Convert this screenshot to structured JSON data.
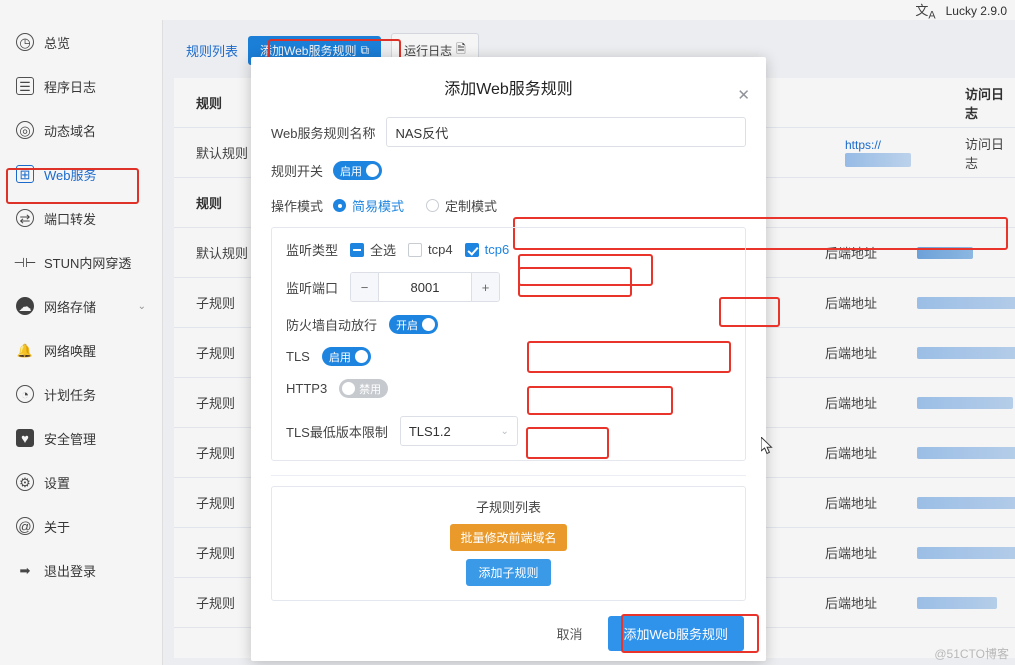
{
  "topbar": {
    "lang_icon": "language-icon",
    "version": "Lucky 2.9.0"
  },
  "sidebar": {
    "items": [
      {
        "label": "总览",
        "icon": "dashboard-icon",
        "name": "overview"
      },
      {
        "label": "程序日志",
        "icon": "log-icon",
        "name": "logs"
      },
      {
        "label": "动态域名",
        "icon": "ddns-icon",
        "name": "ddns"
      },
      {
        "label": "Web服务",
        "icon": "web-service-icon",
        "name": "web-service"
      },
      {
        "label": "端口转发",
        "icon": "port-forward-icon",
        "name": "port-forward"
      },
      {
        "label": "STUN内网穿透",
        "icon": "stun-icon",
        "name": "stun"
      },
      {
        "label": "网络存储",
        "icon": "storage-icon",
        "name": "storage",
        "chevron": "⌄"
      },
      {
        "label": "网络唤醒",
        "icon": "wol-icon",
        "name": "wol"
      },
      {
        "label": "计划任务",
        "icon": "schedule-icon",
        "name": "schedule"
      },
      {
        "label": "安全管理",
        "icon": "security-icon",
        "name": "security"
      },
      {
        "label": "设置",
        "icon": "settings-icon",
        "name": "settings"
      },
      {
        "label": "关于",
        "icon": "about-icon",
        "name": "about"
      },
      {
        "label": "退出登录",
        "icon": "logout-icon",
        "name": "logout"
      }
    ],
    "active_index": 3
  },
  "main": {
    "tab_label": "规则列表",
    "add_rule_button": "添加Web服务规则",
    "add_rule_icon": "copy-icon",
    "log_button": "运行日志",
    "log_icon": "doc-icon",
    "table": {
      "headers": [
        "规则",
        "",
        "",
        "",
        "访问日志"
      ],
      "header_rule": "规则",
      "header_access_log": "访问日志",
      "rows": [
        {
          "rule": "默认规则",
          "backend": "",
          "https": "https://",
          "last": "访问日志"
        },
        {
          "rule": "规则",
          "backend": "",
          "https": "",
          "last": ""
        },
        {
          "rule": "默认规则",
          "backend": "后端地址",
          "https": "",
          "last": ""
        },
        {
          "rule": "子规则",
          "backend": "后端地址",
          "https": "",
          "last": ""
        },
        {
          "rule": "子规则",
          "backend": "后端地址",
          "https": "",
          "last": ""
        },
        {
          "rule": "子规则",
          "backend": "后端地址",
          "https": "",
          "last": ""
        },
        {
          "rule": "子规则",
          "backend": "后端地址",
          "https": "",
          "last": ""
        },
        {
          "rule": "子规则",
          "backend": "后端地址",
          "https": "",
          "last": ""
        },
        {
          "rule": "子规则",
          "backend": "后端地址",
          "https": "",
          "last": ""
        },
        {
          "rule": "子规则",
          "backend": "后端地址",
          "https": "",
          "last": ""
        }
      ]
    }
  },
  "modal": {
    "title": "添加Web服务规则",
    "close_icon": "close-icon",
    "name_label": "Web服务规则名称",
    "name_value": "NAS反代",
    "switch_label": "规则开关",
    "switch_state": "启用",
    "mode_label": "操作模式",
    "mode_simple": "简易模式",
    "mode_custom": "定制模式",
    "mode_selected": "简易模式",
    "listen_type_label": "监听类型",
    "listen_all": "全选",
    "listen_tcp4": "tcp4",
    "listen_tcp6": "tcp6",
    "listen_port_label": "监听端口",
    "listen_port_value": "8001",
    "minus_icon": "minus-icon",
    "plus_icon": "plus-icon",
    "firewall_label": "防火墙自动放行",
    "firewall_state": "开启",
    "tls_label": "TLS",
    "tls_state": "启用",
    "http3_label": "HTTP3",
    "http3_state": "禁用",
    "tls_min_label": "TLS最低版本限制",
    "tls_min_value": "TLS1.2",
    "chevron_icon": "chevron-down-icon",
    "sub_rule_title": "子规则列表",
    "batch_edit_button": "批量修改前端域名",
    "add_sub_rule_button": "添加子规则",
    "cancel_button": "取消",
    "submit_button": "添加Web服务规则"
  },
  "watermark": "@51CTO博客",
  "colors": {
    "accent": "#1d84e0",
    "highlight": "#e8342a",
    "orange": "#e99a2b"
  }
}
